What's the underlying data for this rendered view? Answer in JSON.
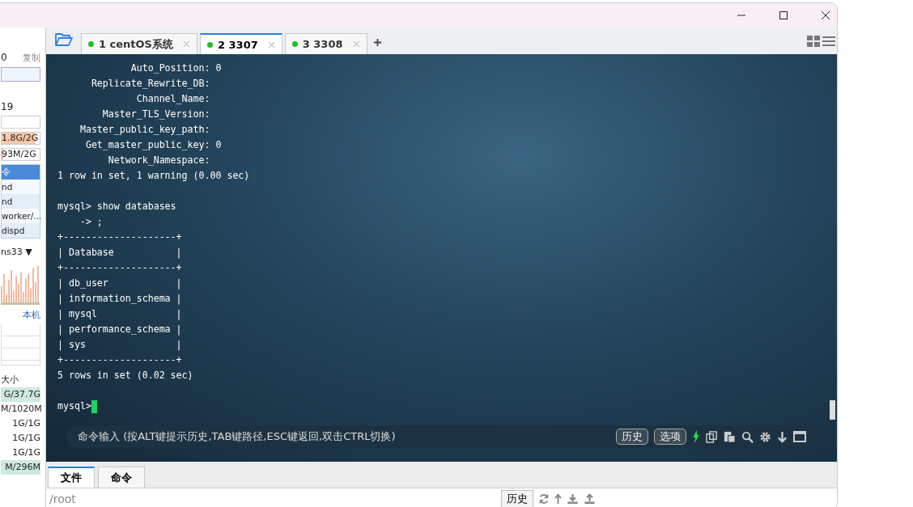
{
  "sidebar": {
    "top_value": "0",
    "copy_link": "复制",
    "uptime": "19",
    "meters": [
      {
        "reading": "1.8G/2G",
        "level": 0.9
      },
      {
        "reading": "93M/2G",
        "level": 0.05
      }
    ],
    "process_header": "令",
    "processes": [
      {
        "label": "nd",
        "selected": false
      },
      {
        "label": "nd",
        "selected": false
      },
      {
        "label": "worker/...",
        "selected": false
      },
      {
        "label": "dispd",
        "selected": false
      }
    ],
    "interface": "ns33 ▼",
    "host_link": "本机",
    "disk_header": "大小",
    "disks": [
      {
        "label": "G/37.7G",
        "level": 1
      },
      {
        "label": "M/1020M"
      },
      {
        "label": "1G/1G"
      },
      {
        "label": "1G/1G"
      },
      {
        "label": "1G/1G"
      },
      {
        "label": "M/296M",
        "level": 1
      }
    ]
  },
  "tabs": [
    {
      "label": "1 centOS系统",
      "selected": false,
      "connected": true
    },
    {
      "label": "2 3307",
      "selected": true,
      "connected": true
    },
    {
      "label": "3 3308",
      "selected": false,
      "connected": true
    }
  ],
  "terminal": {
    "lines": [
      {
        "text": "             Auto_Position: 0"
      },
      {
        "text": "      Replicate_Rewrite_DB:"
      },
      {
        "text": "              Channel_Name:"
      },
      {
        "text": "        Master_TLS_Version:"
      },
      {
        "text": "    Master_public_key_path:"
      },
      {
        "text": "     Get_master_public_key: 0"
      },
      {
        "text": "         Network_Namespace:"
      },
      {
        "text": "1 row in set, 1 warning (0.00 sec)"
      },
      {
        "text": "mysql> show databases",
        "blank_before": true
      },
      {
        "text": "    -> ;"
      },
      {
        "text": "+--------------------+"
      },
      {
        "text": "| Database           |"
      },
      {
        "text": "+--------------------+"
      },
      {
        "text": "| db_user            |"
      },
      {
        "text": "| information_schema |"
      },
      {
        "text": "| mysql              |"
      },
      {
        "text": "| performance_schema |"
      },
      {
        "text": "| sys                |"
      },
      {
        "text": "+--------------------+"
      },
      {
        "text": "5 rows in set (0.02 sec)"
      },
      {
        "text": "mysql>",
        "blank_before": true,
        "kind": "prompt"
      }
    ]
  },
  "command_bar": {
    "placeholder": "命令输入 (按ALT键提示历史,TAB键路径,ESC键返回,双击CTRL切换)",
    "buttons": [
      "历史",
      "选项"
    ]
  },
  "bottom_tabs": [
    {
      "label": "文件",
      "selected": true
    },
    {
      "label": "命令",
      "selected": false
    }
  ],
  "path_field": {
    "value": "/root"
  },
  "history_button": "历史"
}
